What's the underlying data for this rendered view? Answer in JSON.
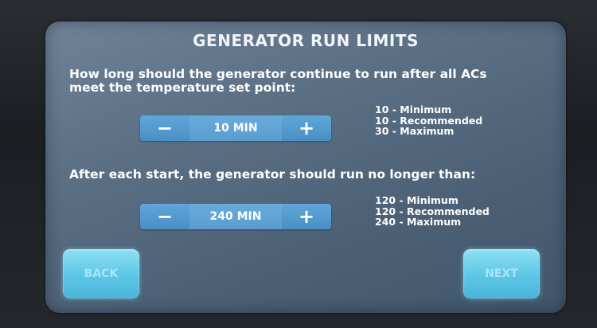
{
  "screen": {
    "title": "GENERATOR RUN LIMITS"
  },
  "section1": {
    "question_line1": "How long should the generator continue to run after all ACs",
    "question_line2": "meet the temperature set point:",
    "stepper": {
      "minus": "−",
      "value": "10 MIN",
      "plus": "+"
    },
    "limits": [
      "10 - Minimum",
      "10 - Recommended",
      "30 - Maximum"
    ]
  },
  "section2": {
    "question": "After each start, the generator should run no longer than:",
    "stepper": {
      "minus": "−",
      "value": "240 MIN",
      "plus": "+"
    },
    "limits": [
      "120 - Minimum",
      "120 - Recommended",
      "240 - Maximum"
    ]
  },
  "nav": {
    "back_label": "BACK",
    "next_label": "NEXT"
  }
}
